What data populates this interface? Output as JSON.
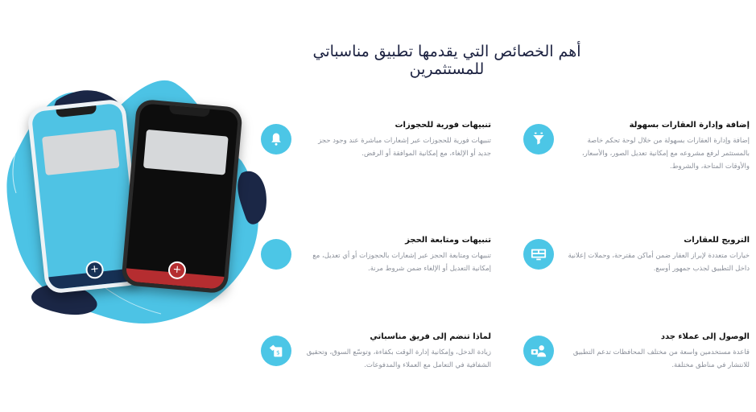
{
  "header": {
    "title": "أهم الخصائص التي يقدمها تطبيق مناسباتي للمستثمرين"
  },
  "features": [
    {
      "title": "تنبيهات فورية للحجوزات",
      "desc": "تنبيهات فورية للحجوزات عبر إشعارات مباشرة عند وجود حجز جديد أو الإلغاء، مع إمكانية الموافقة أو الرفض.",
      "icon": "bell-icon"
    },
    {
      "title": "إضافة وإدارة العقارات بسهولة",
      "desc": "إضافة وإدارة العقارات بسهولة من خلال لوحة تحكم خاصة بالمستثمر لرفع مشروعه مع إمكانية تعديل الصور، والأسعار، والأوقات المتاحة، والشروط.",
      "icon": "funnel-icon"
    },
    {
      "title": "تنبيهات ومتابعة الحجز",
      "desc": "تنبيهات ومتابعة الحجز عبر إشعارات بالحجوزات أو أي تعديل، مع إمكانية التعديل أو الإلغاء ضمن شروط مرنة.",
      "icon": "blank-icon"
    },
    {
      "title": "الترويج للعقارات",
      "desc": "خيارات متعددة لإبراز العقار ضمن أماكن مقترحة، وحملات إعلانية داخل التطبيق لجذب جمهور أوسع.",
      "icon": "promo-screen-icon"
    },
    {
      "title": "لماذا تنضم إلى فريق مناسباتي",
      "desc": "زيادة الدخل، وإمكانية إدارة الوقت بكفاءة، وتوسّع السوق، وتحقيق الشفافية في التعامل مع العملاء والمدفوعات.",
      "icon": "money-tag-icon"
    },
    {
      "title": "الوصول إلى عملاء جدد",
      "desc": "قاعدة مستخدمين واسعة من مختلف المحافظات تدعم التطبيق للانتشار في مناطق مختلفة.",
      "icon": "customer-icon"
    }
  ],
  "colors": {
    "accent": "#4cc6e6",
    "navy": "#173155",
    "red": "#b52d30"
  }
}
